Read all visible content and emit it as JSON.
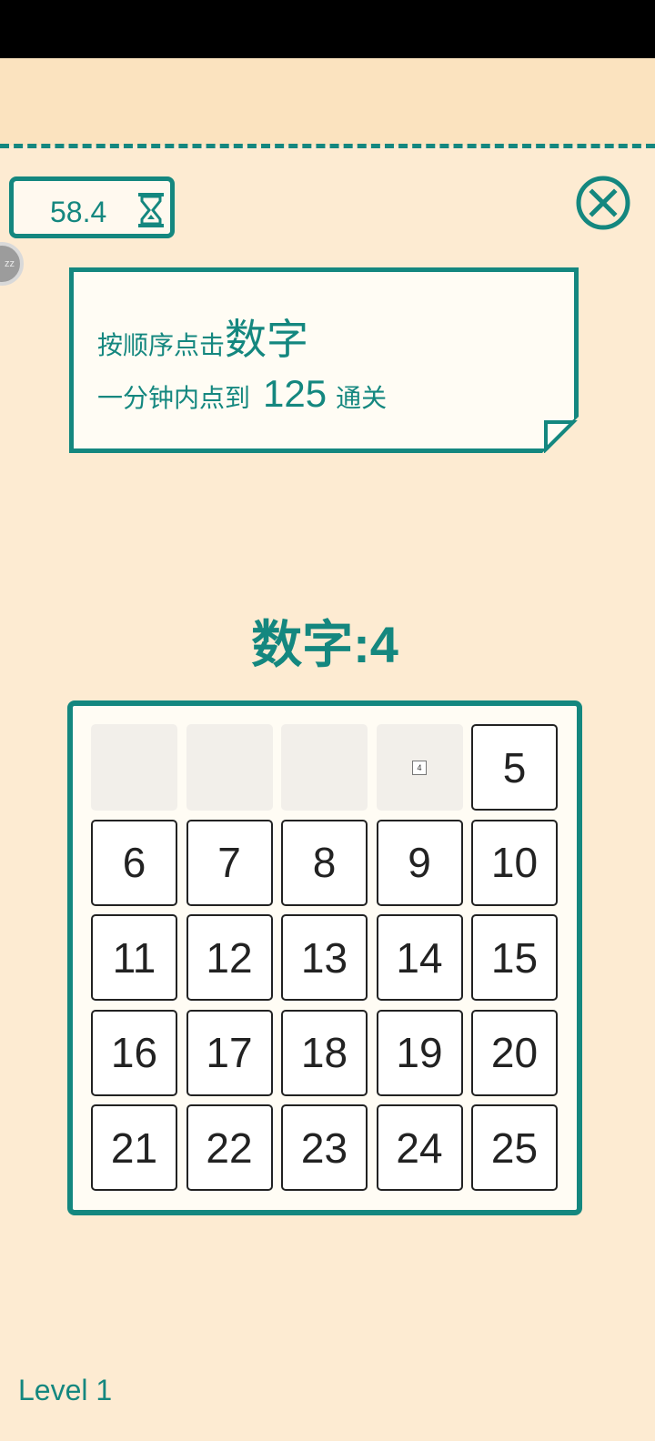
{
  "timer": {
    "value": "58.4",
    "icon": "hourglass-icon"
  },
  "close": {
    "icon": "close-icon"
  },
  "avatar": {
    "label": "zz"
  },
  "instructions": {
    "line1_prefix": "按顺序点击",
    "line1_big": "数字",
    "line2_prefix": "一分钟内点到",
    "line2_big": "125",
    "line2_suffix": "通关"
  },
  "current": {
    "label": "数字:4"
  },
  "board": {
    "tiles": [
      {
        "label": "",
        "cleared": true
      },
      {
        "label": "",
        "cleared": true
      },
      {
        "label": "",
        "cleared": true
      },
      {
        "label": "4",
        "cleared": true,
        "mini": true
      },
      {
        "label": "5"
      },
      {
        "label": "6"
      },
      {
        "label": "7"
      },
      {
        "label": "8"
      },
      {
        "label": "9"
      },
      {
        "label": "10"
      },
      {
        "label": "11"
      },
      {
        "label": "12"
      },
      {
        "label": "13"
      },
      {
        "label": "14"
      },
      {
        "label": "15"
      },
      {
        "label": "16"
      },
      {
        "label": "17"
      },
      {
        "label": "18"
      },
      {
        "label": "19"
      },
      {
        "label": "20"
      },
      {
        "label": "21"
      },
      {
        "label": "22"
      },
      {
        "label": "23"
      },
      {
        "label": "24"
      },
      {
        "label": "25"
      }
    ]
  },
  "footer": {
    "level": "Level 1"
  },
  "colors": {
    "accent": "#14877f",
    "background": "#fdebd2",
    "header": "#fbe3bf"
  }
}
